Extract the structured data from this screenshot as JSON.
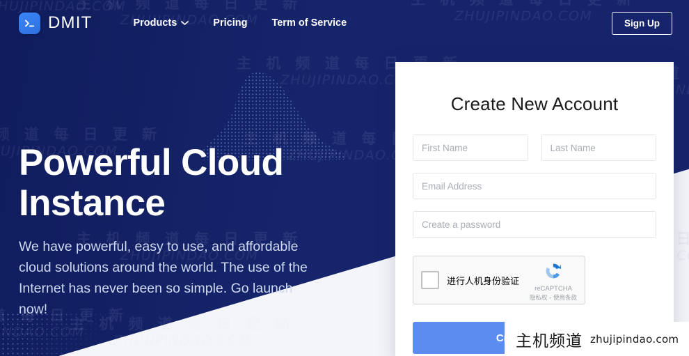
{
  "header": {
    "brand_name": "DMIT",
    "logo_icon": "terminal-prompt-icon",
    "nav_items": [
      {
        "label": "Products",
        "has_dropdown": true,
        "icon": "chevron-down-icon"
      },
      {
        "label": "Pricing",
        "has_dropdown": false
      },
      {
        "label": "Term of Service",
        "has_dropdown": false
      }
    ],
    "signup_label": "Sign Up"
  },
  "hero": {
    "title": "Powerful Cloud Instance",
    "subtitle": "We have powerful, easy to use, and affordable cloud solutions around the world. The use of the Internet has never been so simple. Go launch now!"
  },
  "signup_card": {
    "title": "Create New Account",
    "fields": {
      "first_name": {
        "placeholder": "First Name",
        "value": ""
      },
      "last_name": {
        "placeholder": "Last Name",
        "value": ""
      },
      "email": {
        "placeholder": "Email Address",
        "value": ""
      },
      "password": {
        "placeholder": "Create a password",
        "value": ""
      }
    },
    "recaptcha": {
      "label": "进行人机身份验证",
      "brand": "reCAPTCHA",
      "terms": "隐私权 - 使用条款",
      "logo_icon": "recaptcha-logo-icon",
      "checked": false
    },
    "submit_label": "Create Account"
  },
  "watermark": {
    "cn": "主 机 频 道   每 日 更 新",
    "en": "ZHUJIPINDAO.COM",
    "badge_cn": "主机频道",
    "badge_en": "zhujipindao.com"
  },
  "colors": {
    "hero_background": "#16256b",
    "page_background": "#f4f5f9",
    "accent_blue": "#5b8def",
    "logo_blue": "#3b86f7",
    "card_background": "#ffffff",
    "hero_text": "#ffffff",
    "hero_subtext": "#cfd9f2"
  }
}
